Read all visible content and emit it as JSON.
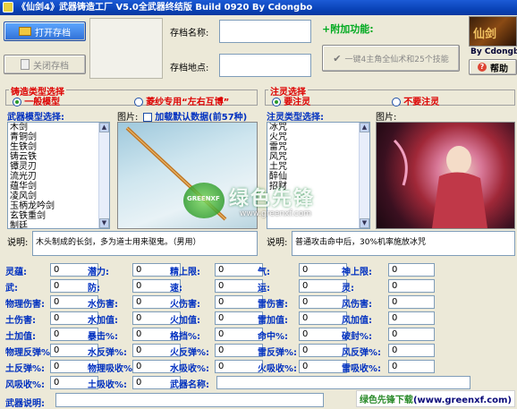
{
  "window": {
    "title": "《仙剑4》武器铸造工厂  V5.0全武器终结版  Build 0920 By Cdongbo"
  },
  "toolbar": {
    "open_save_label": "打开存档",
    "close_save_label": "关闭存档",
    "save_name_label": "存档名称:",
    "save_location_label": "存档地点:",
    "extra_features_label": "+附加功能:",
    "one_click_label": "一键4主角全仙术和25个技能",
    "help_label": "帮助",
    "logo_caption": "By Cdongbo"
  },
  "forge": {
    "group_title": "铸造类型选择",
    "radio_general": "一般模型",
    "radio_sister": "菱纱专用“左右互博”",
    "model_select_label": "武器模型选择:",
    "picture_label": "图片:",
    "load_default_label": "加载默认数据(前57种)",
    "model_items": [
      "木剑",
      "青铜剑",
      "生铁剑",
      "铸云铁",
      "镡灵刃",
      "流光刃",
      "蕴华剑",
      "凌风剑",
      "玉柄龙吟剑",
      "玄铁重剑",
      "制廷"
    ],
    "desc_label": "说明:",
    "desc_text": "木头制成的长剑，多为道士用来驱鬼。（男用）"
  },
  "spirit": {
    "group_title": "注灵选择",
    "radio_need": "要注灵",
    "radio_no": "不要注灵",
    "type_select_label": "注灵类型选择:",
    "picture_label": "图片:",
    "type_items": [
      "冰咒",
      "火咒",
      "雷咒",
      "风咒",
      "土咒",
      "醉仙",
      "招财",
      "",
      "",
      "",
      ""
    ],
    "desc_label": "说明:",
    "desc_text": "普通攻击命中后，30%机率施放冰咒"
  },
  "stats": {
    "rows": [
      [
        {
          "label": "灵蕴:",
          "value": "0"
        },
        {
          "label": "潜力:",
          "value": "0"
        },
        {
          "label": "精上限:",
          "value": "0"
        },
        {
          "label": "气:",
          "value": "0"
        },
        {
          "label": "神上限:",
          "value": "0"
        }
      ],
      [
        {
          "label": "武:",
          "value": "0"
        },
        {
          "label": "防:",
          "value": "0"
        },
        {
          "label": "速:",
          "value": "0"
        },
        {
          "label": "运:",
          "value": "0"
        },
        {
          "label": "灵:",
          "value": "0"
        }
      ],
      [
        {
          "label": "物理伤害:",
          "value": "0"
        },
        {
          "label": "水伤害:",
          "value": "0"
        },
        {
          "label": "火伤害:",
          "value": "0"
        },
        {
          "label": "雷伤害:",
          "value": "0"
        },
        {
          "label": "风伤害:",
          "value": "0"
        }
      ],
      [
        {
          "label": "土伤害:",
          "value": "0"
        },
        {
          "label": "水加值:",
          "value": "0"
        },
        {
          "label": "火加值:",
          "value": "0"
        },
        {
          "label": "雷加值:",
          "value": "0"
        },
        {
          "label": "风加值:",
          "value": "0"
        }
      ],
      [
        {
          "label": "土加值:",
          "value": "0"
        },
        {
          "label": "暴击%:",
          "value": "0"
        },
        {
          "label": "格挡%:",
          "value": "0"
        },
        {
          "label": "命中%:",
          "value": "0"
        },
        {
          "label": "破封%:",
          "value": "0"
        }
      ],
      [
        {
          "label": "物理反弹%:",
          "value": "0"
        },
        {
          "label": "水反弹%:",
          "value": "0"
        },
        {
          "label": "火反弹%:",
          "value": "0"
        },
        {
          "label": "雷反弹%:",
          "value": "0"
        },
        {
          "label": "风反弹%:",
          "value": "0"
        }
      ],
      [
        {
          "label": "土反弹%:",
          "value": "0"
        },
        {
          "label": "物理吸收%:",
          "value": "0"
        },
        {
          "label": "水吸收%:",
          "value": "0"
        },
        {
          "label": "火吸收%:",
          "value": "0"
        },
        {
          "label": "雷吸收%:",
          "value": "0"
        }
      ],
      [
        {
          "label": "风吸收%:",
          "value": "0"
        },
        {
          "label": "土吸收%:",
          "value": "0"
        },
        {
          "label": "武器名称:",
          "value": ""
        },
        {
          "label": "",
          "value": ""
        },
        {
          "label": "",
          "value": ""
        }
      ]
    ],
    "weapon_desc_label": "武器说明:"
  },
  "watermark": {
    "text": "绿色先锋",
    "url": "www.greenxf.com",
    "badge": "GREENXF"
  },
  "footer": {
    "brand": "绿色先锋下载",
    "site": "(www.greenxf.com)"
  },
  "colors": {
    "title_blue": "#0a43b8",
    "label_red": "#d00000",
    "label_blue": "#0030c0"
  }
}
